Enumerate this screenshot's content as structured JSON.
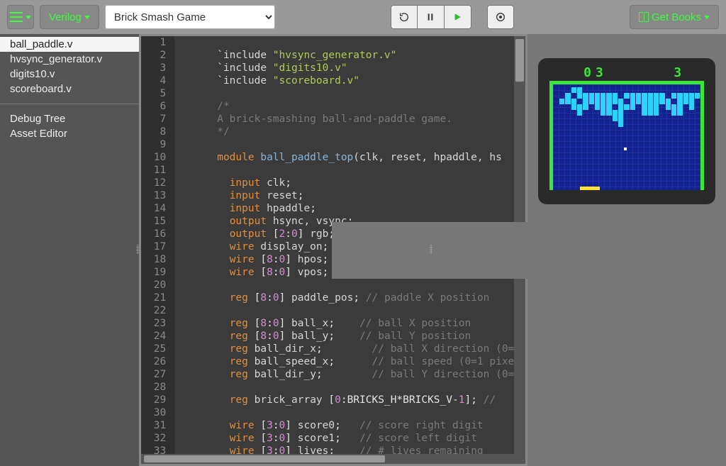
{
  "toolbar": {
    "lang_label": "Verilog",
    "selector_value": "Brick Smash Game",
    "get_books_label": "Get Books"
  },
  "sidebar": {
    "files": [
      {
        "name": "ball_paddle.v",
        "active": true
      },
      {
        "name": "hvsync_generator.v",
        "active": false
      },
      {
        "name": "digits10.v",
        "active": false
      },
      {
        "name": "scoreboard.v",
        "active": false
      }
    ],
    "tools": [
      {
        "name": "Debug Tree"
      },
      {
        "name": "Asset Editor"
      }
    ]
  },
  "editor": {
    "first_line": 1,
    "last_line": 33,
    "lines": [
      {
        "n": 1,
        "html": ""
      },
      {
        "n": 2,
        "html": "<span class='tok-inc'>`include </span><span class='tok-str'>\"hvsync_generator.v\"</span>"
      },
      {
        "n": 3,
        "html": "<span class='tok-inc'>`include </span><span class='tok-str'>\"digits10.v\"</span>"
      },
      {
        "n": 4,
        "html": "<span class='tok-inc'>`include </span><span class='tok-str'>\"scoreboard.v\"</span>"
      },
      {
        "n": 5,
        "html": ""
      },
      {
        "n": 6,
        "html": "<span class='tok-cmt'>/*</span>"
      },
      {
        "n": 7,
        "html": "<span class='tok-cmt'>A brick-smashing ball-and-paddle game.</span>"
      },
      {
        "n": 8,
        "html": "<span class='tok-cmt'>*/</span>"
      },
      {
        "n": 9,
        "html": ""
      },
      {
        "n": 10,
        "html": "<span class='tok-kw'>module</span> <span class='tok-type'>ball_paddle_top</span><span class='tok-punc'>(clk, reset, hpaddle, hs</span>"
      },
      {
        "n": 11,
        "html": ""
      },
      {
        "n": 12,
        "html": "  <span class='tok-kw'>input</span> <span class='tok-id'>clk</span>;"
      },
      {
        "n": 13,
        "html": "  <span class='tok-kw'>input</span> <span class='tok-id'>reset</span>;"
      },
      {
        "n": 14,
        "html": "  <span class='tok-kw'>input</span> <span class='tok-id'>hpaddle</span>;"
      },
      {
        "n": 15,
        "html": "  <span class='tok-kw'>output</span> <span class='tok-id'>hsync, vsync</span>;"
      },
      {
        "n": 16,
        "html": "  <span class='tok-kw'>output</span> [<span class='tok-num'>2</span>:<span class='tok-num'>0</span>] <span class='tok-id'>rgb</span>;"
      },
      {
        "n": 17,
        "html": "  <span class='tok-kw'>wire</span> <span class='tok-id'>display_on</span>;"
      },
      {
        "n": 18,
        "html": "  <span class='tok-kw'>wire</span> [<span class='tok-num'>8</span>:<span class='tok-num'>0</span>] <span class='tok-id'>hpos</span>;"
      },
      {
        "n": 19,
        "html": "  <span class='tok-kw'>wire</span> [<span class='tok-num'>8</span>:<span class='tok-num'>0</span>] <span class='tok-id'>vpos</span>;"
      },
      {
        "n": 20,
        "html": ""
      },
      {
        "n": 21,
        "html": "  <span class='tok-kw'>reg</span> [<span class='tok-num'>8</span>:<span class='tok-num'>0</span>] <span class='tok-id'>paddle_pos</span>; <span class='tok-cmt'>// paddle X position</span>"
      },
      {
        "n": 22,
        "html": ""
      },
      {
        "n": 23,
        "html": "  <span class='tok-kw'>reg</span> [<span class='tok-num'>8</span>:<span class='tok-num'>0</span>] <span class='tok-id'>ball_x</span>;    <span class='tok-cmt'>// ball X position</span>"
      },
      {
        "n": 24,
        "html": "  <span class='tok-kw'>reg</span> [<span class='tok-num'>8</span>:<span class='tok-num'>0</span>] <span class='tok-id'>ball_y</span>;    <span class='tok-cmt'>// ball Y position</span>"
      },
      {
        "n": 25,
        "html": "  <span class='tok-kw'>reg</span> <span class='tok-id'>ball_dir_x</span>;        <span class='tok-cmt'>// ball X direction (0=</span>"
      },
      {
        "n": 26,
        "html": "  <span class='tok-kw'>reg</span> <span class='tok-id'>ball_speed_x</span>;      <span class='tok-cmt'>// ball speed (0=1 pixe</span>"
      },
      {
        "n": 27,
        "html": "  <span class='tok-kw'>reg</span> <span class='tok-id'>ball_dir_y</span>;        <span class='tok-cmt'>// ball Y direction (0=</span>"
      },
      {
        "n": 28,
        "html": ""
      },
      {
        "n": 29,
        "html": "  <span class='tok-kw'>reg</span> <span class='tok-id'>brick_array</span> [<span class='tok-num'>0</span>:BRICKS_H*BRICKS_V-<span class='tok-num'>1</span>]; <span class='tok-cmt'>// </span>"
      },
      {
        "n": 30,
        "html": ""
      },
      {
        "n": 31,
        "html": "  <span class='tok-kw'>wire</span> [<span class='tok-num'>3</span>:<span class='tok-num'>0</span>] <span class='tok-id'>score0</span>;   <span class='tok-cmt'>// score right digit</span>"
      },
      {
        "n": 32,
        "html": "  <span class='tok-kw'>wire</span> [<span class='tok-num'>3</span>:<span class='tok-num'>0</span>] <span class='tok-id'>score1</span>;   <span class='tok-cmt'>// score left digit</span>"
      },
      {
        "n": 33,
        "html": "  <span class='tok-kw'>wire</span> [<span class='tok-num'>3</span>:<span class='tok-num'>0</span>] <span class='tok-id'>lives</span>;    <span class='tok-cmt'>// # lives remaining</span>"
      }
    ]
  },
  "emulator": {
    "score_left": "03",
    "score_right": "3",
    "brick_rows": [
      "0001100000000000000000000",
      "0010111111101111111011111",
      "0111011111110111111101110",
      "0001110111011101110111010",
      "0000100011110001110011000",
      "0000000000110000000000000",
      "0000000000010000000000000",
      "0000000000000000000000000"
    ]
  }
}
